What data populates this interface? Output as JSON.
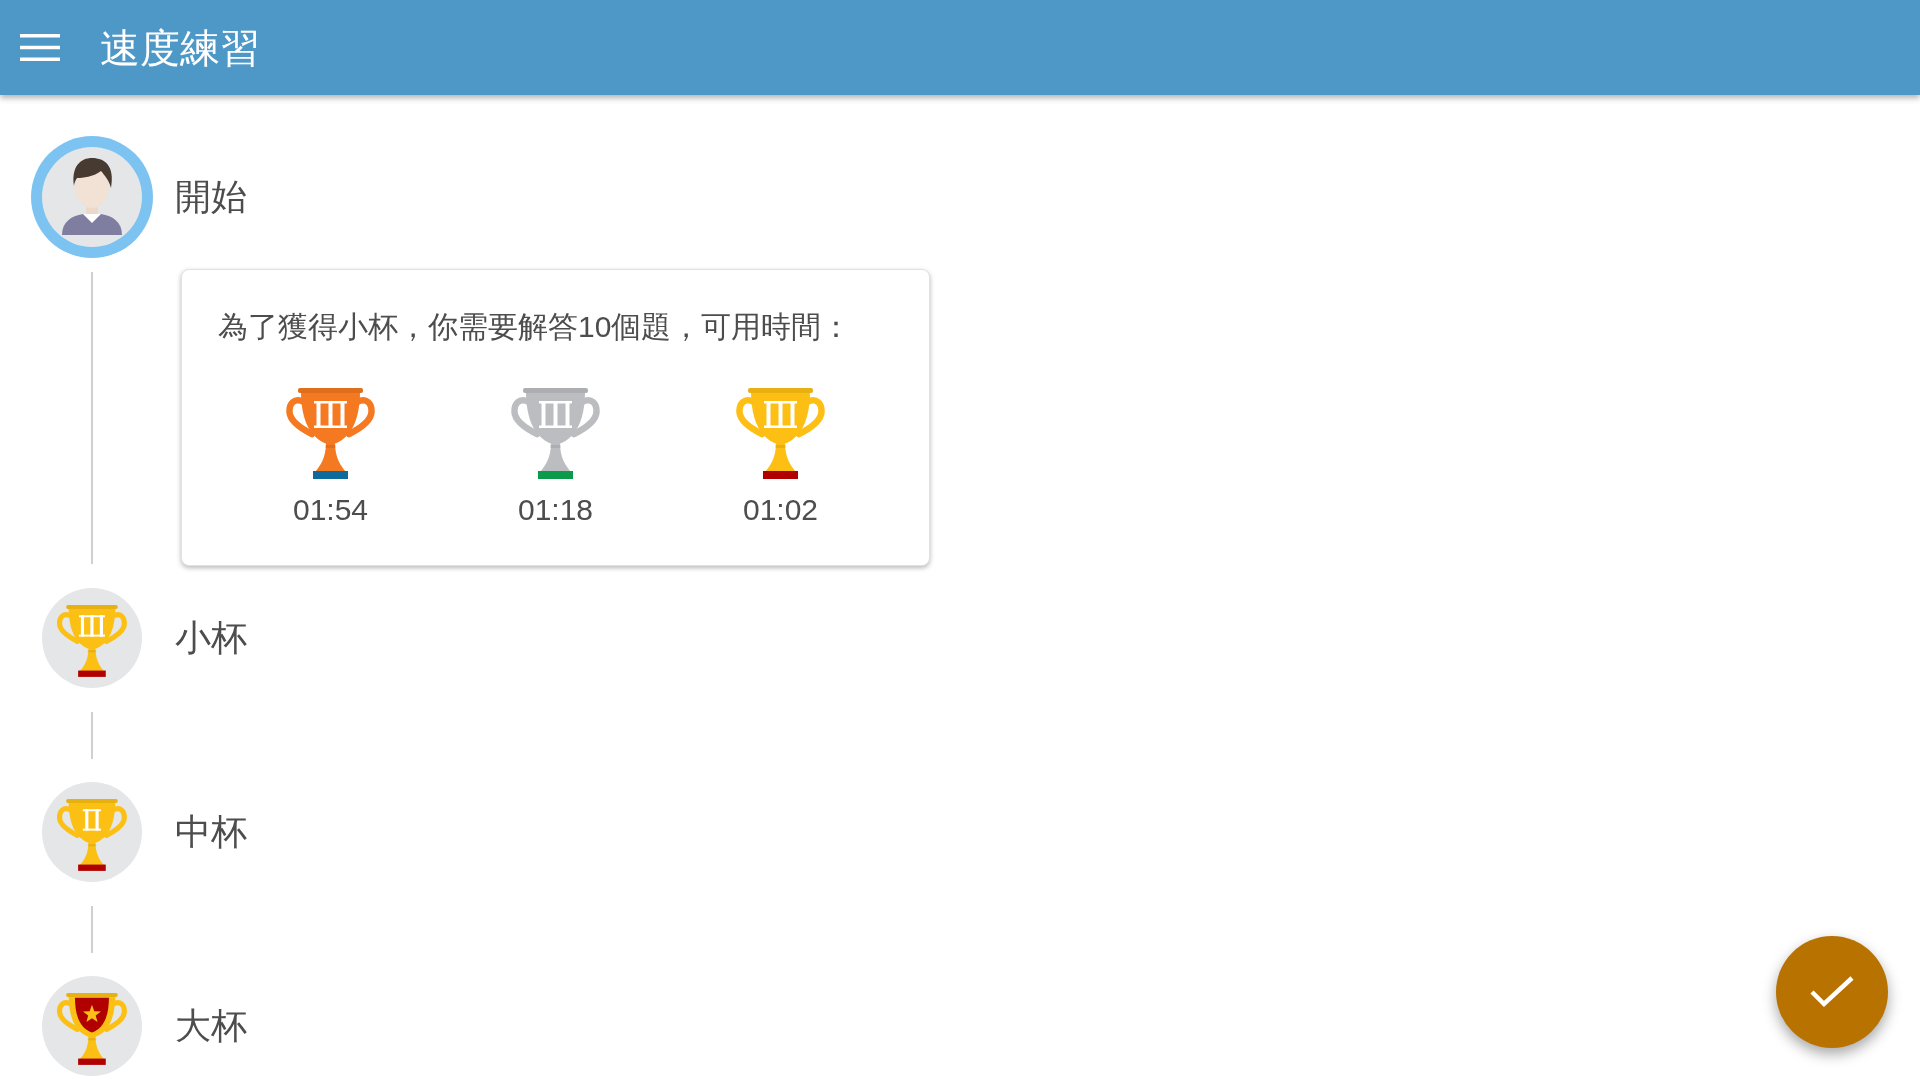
{
  "app_bar": {
    "title": "速度練習"
  },
  "timeline": {
    "start": {
      "label": "開始"
    },
    "requirement_card": {
      "text": "為了獲得小杯，你需要解答10個題，可用時間：",
      "trophies": [
        {
          "time": "01:54",
          "kind": "bronze",
          "color": "#f47920"
        },
        {
          "time": "01:18",
          "kind": "silver",
          "color": "#bcbdc0"
        },
        {
          "time": "01:02",
          "kind": "gold",
          "color": "#fdbf14"
        }
      ]
    },
    "cups": [
      {
        "label": "小杯",
        "kind": "small"
      },
      {
        "label": "中杯",
        "kind": "medium"
      },
      {
        "label": "大杯",
        "kind": "large"
      }
    ]
  }
}
